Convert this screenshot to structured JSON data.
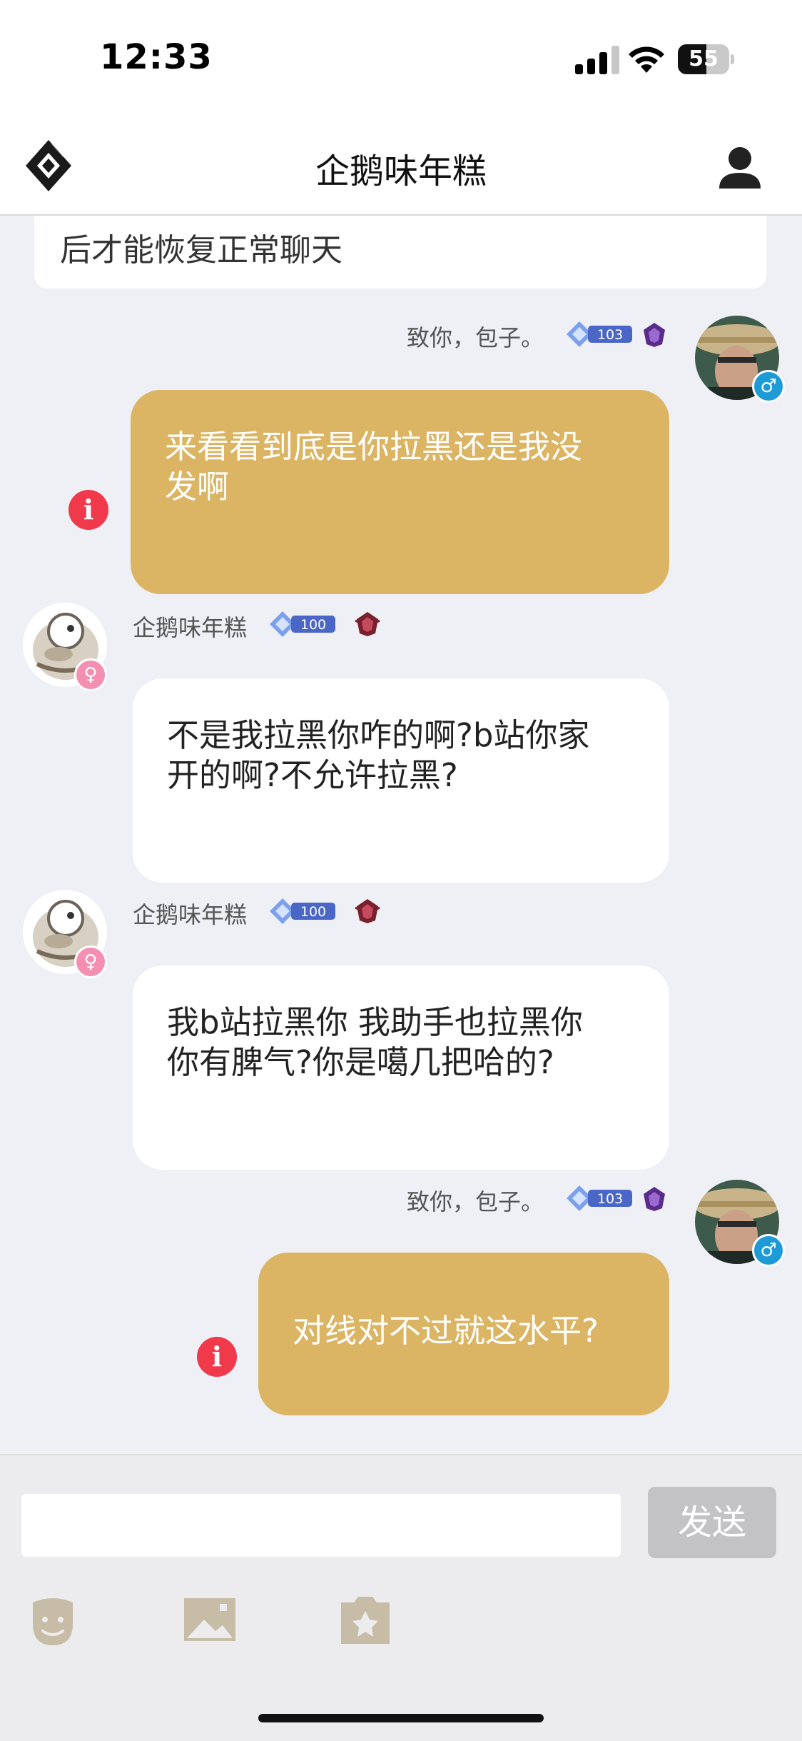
{
  "status_bar": {
    "time": "12:33",
    "battery": "55",
    "battery_level": 0.55
  },
  "nav": {
    "title": "企鹅味年糕",
    "logo_icon": "app-logo-icon",
    "profile_icon": "user-profile-icon"
  },
  "notice": {
    "text": "后才能恢复正常聊天"
  },
  "messages": [
    {
      "sender": "致你，包子。",
      "level": "103",
      "side": "right",
      "text": "来看看到底是你拉黑还是我没发啊",
      "lines": [
        "来看看到底是你拉黑还是我没",
        "发啊"
      ],
      "failed": true
    },
    {
      "sender": "企鹅味年糕",
      "level": "100",
      "side": "left",
      "text": "不是我拉黑你咋的啊?b站你家开的啊?不允许拉黑?",
      "lines": [
        "不是我拉黑你咋的啊?b站你家",
        "开的啊?不允许拉黑?"
      ],
      "failed": false
    },
    {
      "sender": "企鹅味年糕",
      "level": "100",
      "side": "left",
      "text": "我b站拉黑你 我助手也拉黑你你有脾气?你是噶几把哈的?",
      "lines": [
        "我b站拉黑你 我助手也拉黑你",
        "你有脾气?你是噶几把哈的?"
      ],
      "failed": false
    },
    {
      "sender": "致你，包子。",
      "level": "103",
      "side": "right",
      "text": "对线对不过就这水平?",
      "lines": [
        "对线对不过就这水平?"
      ],
      "failed": true
    }
  ],
  "input": {
    "placeholder": "",
    "value": ""
  },
  "send_button": {
    "label": "发送"
  },
  "toolbar": {
    "icons": [
      "emoji-face-icon",
      "image-icon",
      "photo-album-icon"
    ]
  },
  "colors": {
    "self_bubble": "#dbb563",
    "other_bubble": "#ffffff",
    "error": "#f0394a",
    "background": "#eef0f5"
  }
}
